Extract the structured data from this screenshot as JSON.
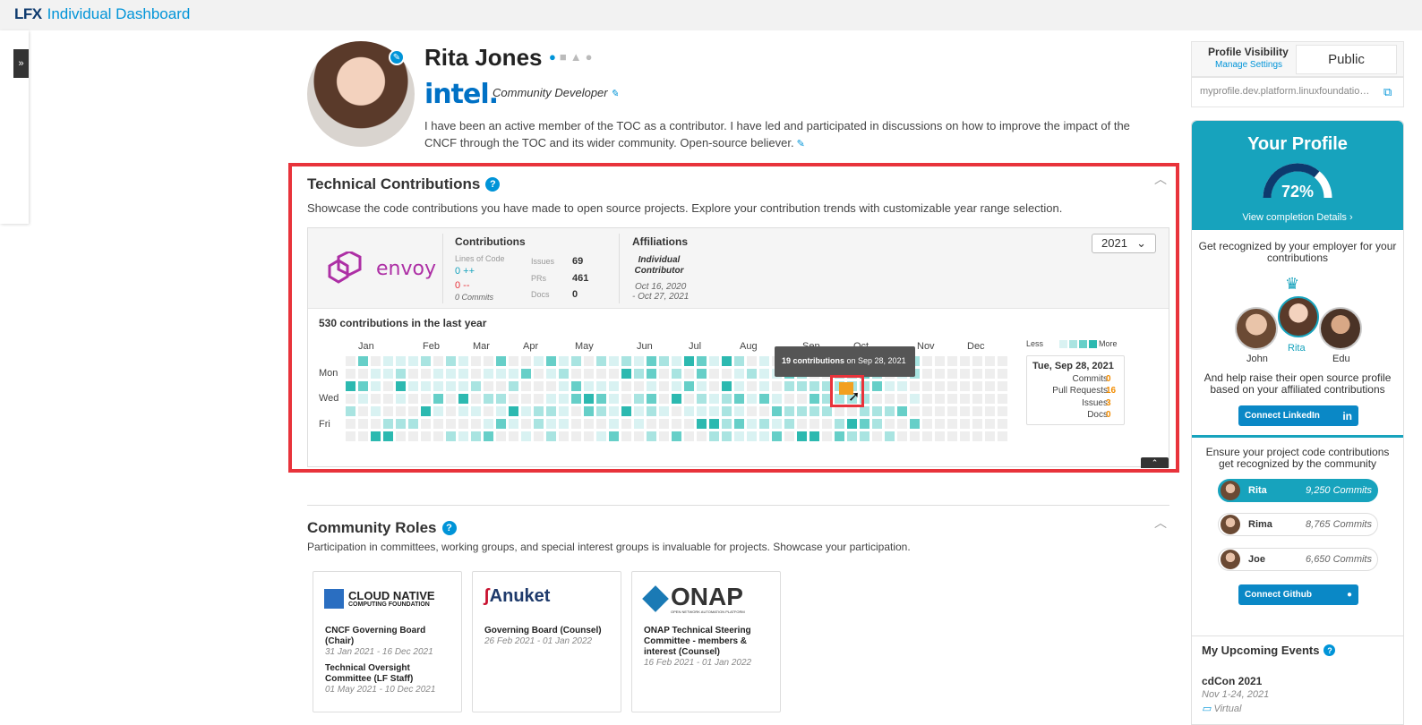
{
  "header": {
    "logo": "LFX",
    "title": "Individual Dashboard"
  },
  "sidebar": {
    "expand_icon": "»"
  },
  "profile": {
    "name": "Rita Jones",
    "company": "intel.",
    "role": "Community Developer",
    "bio": "I have been an active member of the TOC as a contributor. I have led and participated in discussions on how to improve the impact of the CNCF through the TOC and its wider community. Open-source believer."
  },
  "technical": {
    "title": "Technical Contributions",
    "description": "Showcase the code contributions you have made to open source projects. Explore your contribution trends with customizable year range selection.",
    "project": "envoy",
    "contributions_label": "Contributions",
    "loc_label": "Lines of Code",
    "loc_added": "0 ++",
    "loc_removed": "0 --",
    "commits": "0 Commits",
    "issues_label": "Issues",
    "issues_value": "69",
    "prs_label": "PRs",
    "prs_value": "461",
    "docs_label": "Docs",
    "docs_value": "0",
    "affiliations_label": "Affiliations",
    "affiliation": "Individual Contributor",
    "affiliation_date1": "Oct 16, 2020",
    "affiliation_date2": "- Oct 27, 2021",
    "year": "2021",
    "heatmap_title": "530 contributions in the last year",
    "months": [
      "Jan",
      "Feb",
      "Mar",
      "Apr",
      "May",
      "Jun",
      "Jul",
      "Aug",
      "Sep",
      "Oct",
      "Nov",
      "Dec"
    ],
    "days": [
      "Mon",
      "Wed",
      "Fri"
    ],
    "legend_less": "Less",
    "legend_more": "More",
    "tooltip_count": "19 contributions",
    "tooltip_date": " on Sep 28, 2021",
    "detail": {
      "date": "Tue, Sep 28, 2021",
      "rows": [
        {
          "label": "Commits",
          "value": "0"
        },
        {
          "label": "Pull Requests",
          "value": "16"
        },
        {
          "label": "Issues",
          "value": "3"
        },
        {
          "label": "Docs",
          "value": "0"
        }
      ]
    },
    "colors": {
      "level1": "#d9f2f2",
      "level2": "#a9e4e1",
      "level3": "#66cfc8",
      "level4": "#2cb9b0",
      "empty": "#eeeeee",
      "highlight": "#e8333b"
    }
  },
  "community": {
    "title": "Community Roles",
    "description": "Participation in committees, working groups, and special interest groups is invaluable for projects. Showcase your participation.",
    "cards": [
      {
        "logo": "CLOUD NATIVE",
        "logo_sub": "COMPUTING FOUNDATION",
        "r1": "CNCF Governing Board (Chair)",
        "d1": "31 Jan 2021 - 16 Dec 2021",
        "r2": "Technical Oversight Committee (LF Staff)",
        "d2": "01 May 2021 - 10 Dec 2021"
      },
      {
        "logo": "Anuket",
        "r1": "Governing Board (Counsel)",
        "d1": "26 Feb 2021 - 01 Jan 2022"
      },
      {
        "logo": "ONAP",
        "logo_sub": "OPEN NETWORK AUTOMATION PLATFORM",
        "r1": "ONAP Technical Steering Committee - members & interest (Counsel)",
        "d1": "16 Feb 2021 - 01 Jan 2022"
      }
    ]
  },
  "right": {
    "visibility_label": "Profile Visibility",
    "manage_settings": "Manage Settings",
    "visibility_value": "Public",
    "profile_url": "myprofile.dev.platform.linuxfoundation.org/rita",
    "your_profile": "Your Profile",
    "completion": "72%",
    "completion_value": 0.72,
    "view_details": "View completion Details",
    "employer_text": "Get recognized by your employer for your contributions",
    "people": [
      "John",
      "Rita",
      "Edu"
    ],
    "raise_text": "And help raise their open source profile based on your affiliated contributions",
    "connect_linkedin": "Connect LinkedIn",
    "ensure_text": "Ensure your project code contributions get recognized by the community",
    "leaderboard": [
      {
        "name": "Rita",
        "commits": "9,250 Commits"
      },
      {
        "name": "Rima",
        "commits": "8,765 Commits"
      },
      {
        "name": "Joe",
        "commits": "6,650 Commits"
      }
    ],
    "connect_github": "Connect Github",
    "events_title": "My Upcoming Events",
    "event_name": "cdCon 2021",
    "event_date": "Nov 1-24, 2021",
    "event_location": "Virtual"
  }
}
